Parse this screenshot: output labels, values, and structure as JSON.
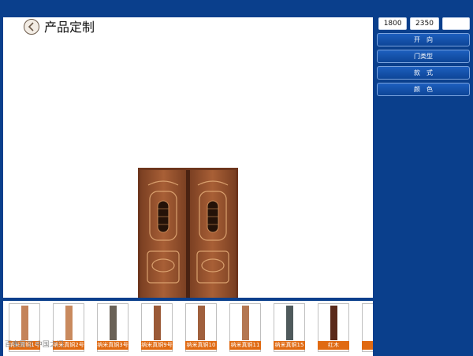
{
  "header": {
    "title": "产品定制"
  },
  "panel": {
    "width_value": "1800",
    "height_value": "2350",
    "third_value": "",
    "menu": [
      "开　向",
      "门类型",
      "款　式",
      "颜　色"
    ]
  },
  "thumbnails": [
    {
      "label": "纳米真铜1号",
      "color": "#c4835a"
    },
    {
      "label": "纳米真铜2号",
      "color": "#c98a5e"
    },
    {
      "label": "纳米真铜3号",
      "color": "#6a6257"
    },
    {
      "label": "纳米真铜9号",
      "color": "#9b5a37"
    },
    {
      "label": "纳米真铜10",
      "color": "#a0603d"
    },
    {
      "label": "纳米真铜11",
      "color": "#b47752"
    },
    {
      "label": "纳米真铜15",
      "color": "#4f5a5c"
    },
    {
      "label": "红木",
      "color": "#5a2a1a"
    },
    {
      "label": "红",
      "color": "#6b2a1a"
    }
  ],
  "watermark": "百事厨卫 中国之门"
}
